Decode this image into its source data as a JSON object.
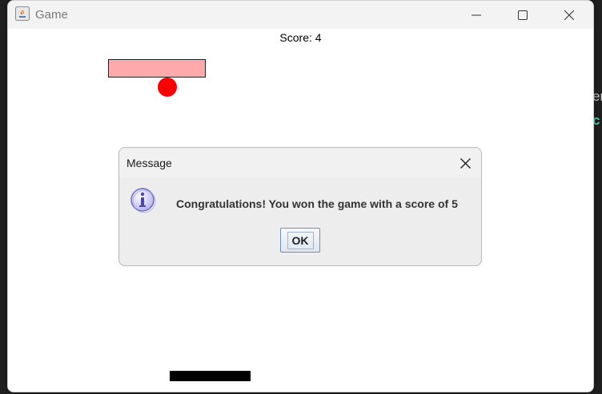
{
  "window": {
    "title": "Game"
  },
  "game": {
    "score_label": "Score: 4"
  },
  "dialog": {
    "title": "Message",
    "message": "Congratulations! You won the game with a score of 5",
    "ok_label": "OK"
  },
  "background": {
    "fragment_1": "er",
    "fragment_2": "c"
  },
  "colors": {
    "brick": "#ffaaaa",
    "ball": "#ff0000",
    "paddle": "#000000",
    "dialog_bg": "#ededed"
  },
  "icons": {
    "app": "java-icon",
    "dialog": "info-icon",
    "minimize": "minimize-icon",
    "maximize": "maximize-icon",
    "close": "close-icon"
  }
}
